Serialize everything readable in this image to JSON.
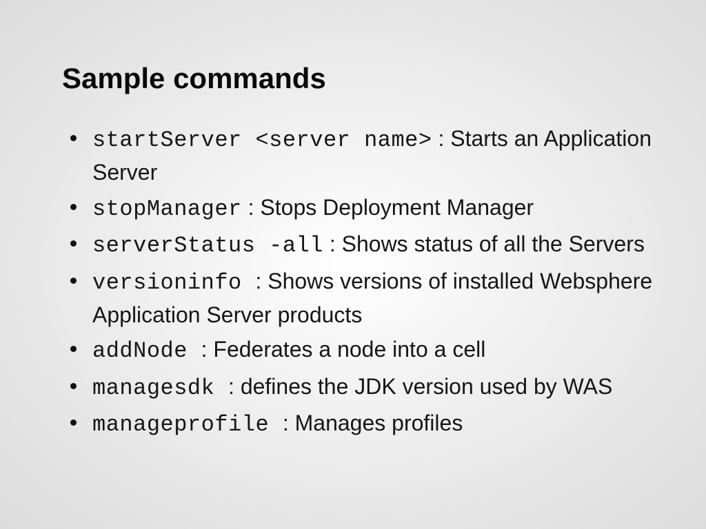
{
  "title": "Sample commands",
  "items": {
    "i0": {
      "cmd": "startServer <server name>",
      "desc": " : Starts an Application Server"
    },
    "i1": {
      "cmd": "stopManager",
      "desc": " : Stops Deployment Manager"
    },
    "i2": {
      "cmd": "serverStatus -all",
      "desc": " : Shows status of all the Servers"
    },
    "i3": {
      "cmd": "versioninfo ",
      "desc": " : Shows versions of installed Websphere Application Server products"
    },
    "i4": {
      "cmd": "addNode ",
      "desc": " : Federates a node into a cell"
    },
    "i5": {
      "cmd": "managesdk ",
      "desc": " : defines the JDK version used by WAS"
    },
    "i6": {
      "cmd": "manageprofile ",
      "desc": " : Manages profiles"
    }
  }
}
